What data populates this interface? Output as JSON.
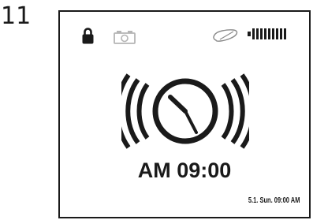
{
  "step": {
    "number": "11"
  },
  "status_bar": {
    "icons": [
      "lock-icon",
      "camera-icon",
      "link-icon",
      "battery-icon"
    ]
  },
  "alarm": {
    "icon": "alarm-clock-ringing-icon",
    "time": "AM 09:00",
    "date_line": "5.1. Sun. 09:00 AM"
  },
  "colors": {
    "foreground": "#1a1a1a",
    "dim_icon": "#b5b5b5",
    "background": "#ffffff"
  }
}
